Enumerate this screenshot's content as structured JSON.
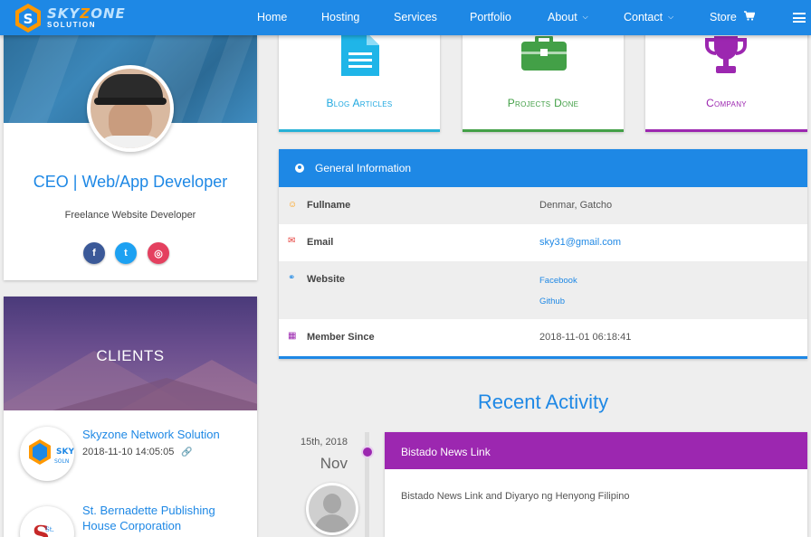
{
  "brand": {
    "line1_a": "SKY",
    "line1_z": "Z",
    "line1_b": "ONE",
    "line2": "SOLUTION"
  },
  "nav": {
    "home": "Home",
    "hosting": "Hosting",
    "services": "Services",
    "portfolio": "Portfolio",
    "about": "About",
    "contact": "Contact",
    "store": "Store"
  },
  "profile": {
    "title": "CEO | Web/App Developer",
    "subtitle": "Freelance Website Developer",
    "social": {
      "facebook": "f",
      "twitter": "t",
      "instagram": "◎"
    }
  },
  "clients": {
    "title": "CLIENTS",
    "items": [
      {
        "name": "Skyzone Network Solution",
        "date": "2018-11-10 14:05:05"
      },
      {
        "name": "St. Bernadette Publishing House Corporation",
        "date": ""
      }
    ]
  },
  "stats": [
    {
      "label": "Blog Articles",
      "icon": "document-icon",
      "color": "#1fa8e0"
    },
    {
      "label": "Projects Done",
      "icon": "briefcase-icon",
      "color": "#43a047"
    },
    {
      "label": "Company",
      "icon": "trophy-icon",
      "color": "#9c27b0"
    }
  ],
  "info": {
    "title": "General Information",
    "rows": {
      "fullname": {
        "key": "Fullname",
        "value": "Denmar, Gatcho"
      },
      "email": {
        "key": "Email",
        "value": "sky31@gmail.com"
      },
      "website": {
        "key": "Website",
        "links": [
          "Facebook",
          "Github"
        ]
      },
      "member": {
        "key": "Member Since",
        "value": "2018-11-01 06:18:41"
      }
    }
  },
  "activity": {
    "title": "Recent Activity",
    "date": "15th, 2018",
    "month": "Nov",
    "card_title": "Bistado News Link",
    "card_body": "Bistado News Link and Diyaryo ng Henyong Filipino"
  },
  "colors": {
    "primary": "#1e88e5",
    "green": "#43a047",
    "purple": "#9c27b0",
    "cyan": "#1fa8e0"
  }
}
